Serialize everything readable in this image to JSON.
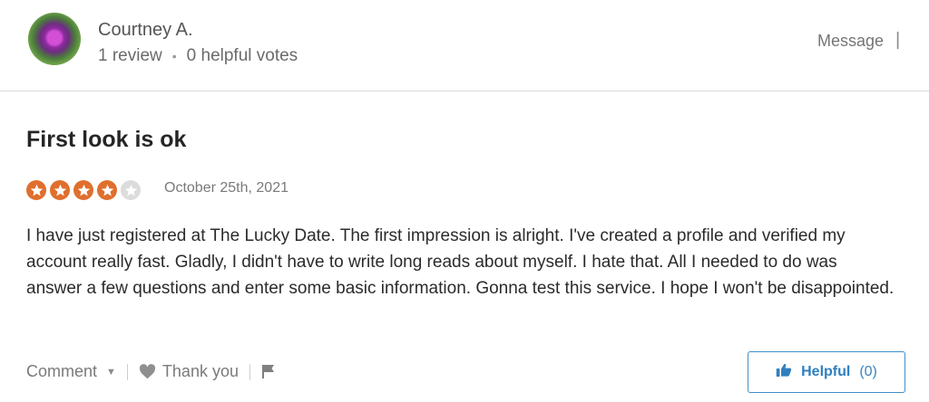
{
  "author": {
    "name": "Courtney A.",
    "reviews": "1 review",
    "helpful_votes": "0 helpful votes"
  },
  "header": {
    "message_label": "Message",
    "separator": "|"
  },
  "review": {
    "title": "First look is ok",
    "rating": 4,
    "rating_max": 5,
    "date": "October 25th, 2021",
    "body": "I have just registered at The Lucky Date. The first impression is alright. I've created a profile and verified my account really fast. Gladly, I didn't have to write long reads about myself. I hate that. All I needed to do was answer a few questions and enter some basic information. Gonna test this service. I hope I won't be disappointed."
  },
  "actions": {
    "comment_label": "Comment",
    "thank_you_label": "Thank you",
    "helpful_label": "Helpful",
    "helpful_count": "(0)"
  },
  "colors": {
    "star_filled": "#e06f2e",
    "star_empty": "#dcdcdc",
    "helpful_accent": "#2f7fbf"
  },
  "icons": [
    "star-icon",
    "caret-down-icon",
    "heart-icon",
    "flag-icon",
    "thumbs-up-icon"
  ]
}
